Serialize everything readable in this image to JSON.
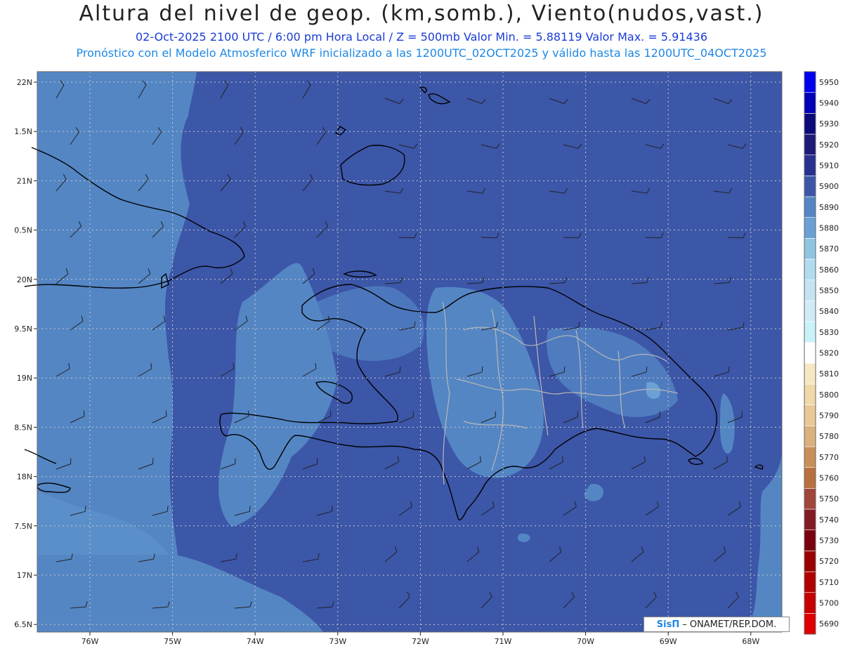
{
  "header": {
    "title": "Altura del nivel de geop. (km,somb.), Viento(nudos,vast.)",
    "subtitle1": "02-Oct-2025  2100 UTC / 6:00 pm Hora Local / Z = 500mb     Valor Min. = 5.88119  Valor Max. = 5.91436",
    "subtitle2": "Pronóstico con el Modelo Atmosferico WRF inicializado a las 1200UTC_02OCT2025 y válido hasta las  1200UTC_04OCT2025"
  },
  "map": {
    "lat_labels": [
      "22N",
      "1.5N",
      "21N",
      "0.5N",
      "20N",
      "9.5N",
      "19N",
      "8.5N",
      "18N",
      "7.5N",
      "17N",
      "6.5N"
    ],
    "lon_labels": [
      "76W",
      "75W",
      "74W",
      "73W",
      "72W",
      "71W",
      "70W",
      "69W",
      "68W"
    ],
    "colors": {
      "base": "#3c56a8",
      "light": "#5486c4",
      "lighter": "#6aa0d4",
      "coast": "#000000",
      "province": "#b8b8b8"
    }
  },
  "colorbar": {
    "levels": [
      "5690",
      "5700",
      "5710",
      "5720",
      "5730",
      "5740",
      "5750",
      "5760",
      "5770",
      "5780",
      "5790",
      "5800",
      "5810",
      "5820",
      "5830",
      "5840",
      "5850",
      "5860",
      "5870",
      "5880",
      "5890",
      "5900",
      "5910",
      "5920",
      "5930",
      "5940",
      "5950"
    ],
    "colors": [
      "#e00000",
      "#c80000",
      "#b20000",
      "#9a0000",
      "#7a0010",
      "#841a24",
      "#a0463a",
      "#b8703e",
      "#c89058",
      "#dab07c",
      "#e8c894",
      "#f0d8a8",
      "#f6e8c4",
      "#ffffff",
      "#c8f2f8",
      "#d0eaf6",
      "#c4e4f2",
      "#b0dcee",
      "#90c4e2",
      "#6aa0d4",
      "#5486c4",
      "#3c56a8",
      "#283090",
      "#1e1a78",
      "#0a0a7a",
      "#0000b8",
      "#0000f0"
    ]
  },
  "credit": {
    "logo": "SisΠ",
    "text": "– ONAMET/REP.DOM."
  }
}
